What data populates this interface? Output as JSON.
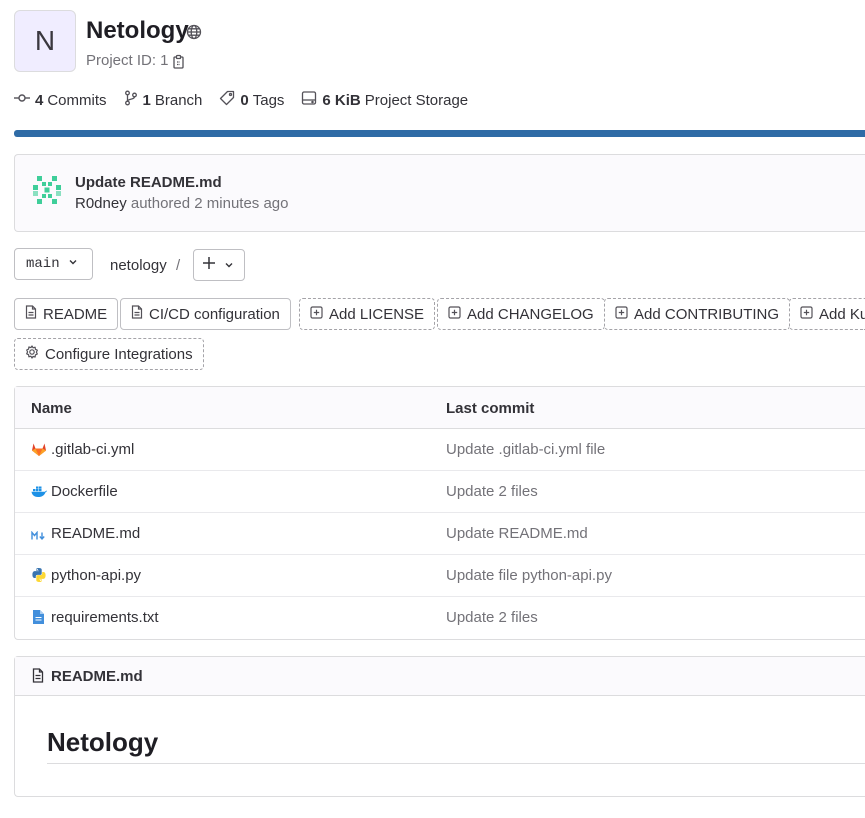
{
  "project": {
    "avatar_letter": "N",
    "name": "Netology",
    "visibility_icon": "globe-icon",
    "id_label": "Project ID: 1"
  },
  "stats": {
    "commits_count": "4",
    "commits_label": "Commits",
    "branches_count": "1",
    "branches_label": "Branch",
    "tags_count": "0",
    "tags_label": "Tags",
    "storage_count": "6 KiB",
    "storage_label": "Project Storage"
  },
  "last_commit": {
    "message": "Update README.md",
    "author": "R0dney",
    "authored": "authored 2 minutes ago"
  },
  "repo_nav": {
    "branch": "main",
    "path": "netology",
    "separator": "/"
  },
  "quick_actions": [
    {
      "label": "README",
      "icon": "file-icon"
    },
    {
      "label": "CI/CD configuration",
      "icon": "file-icon"
    },
    {
      "label": "Add LICENSE",
      "icon": "plus-square-icon"
    },
    {
      "label": "Add CHANGELOG",
      "icon": "plus-square-icon"
    },
    {
      "label": "Add CONTRIBUTING",
      "icon": "plus-square-icon"
    },
    {
      "label": "Add Ku",
      "icon": "plus-square-icon"
    },
    {
      "label": "Configure Integrations",
      "icon": "settings-icon"
    }
  ],
  "file_table": {
    "headers": [
      "Name",
      "Last commit"
    ],
    "rows": [
      {
        "name": ".gitlab-ci.yml",
        "commit": "Update .gitlab-ci.yml file",
        "icon": "gitlab-icon"
      },
      {
        "name": "Dockerfile",
        "commit": "Update 2 files",
        "icon": "docker-icon"
      },
      {
        "name": "README.md",
        "commit": "Update README.md",
        "icon": "markdown-icon"
      },
      {
        "name": "python-api.py",
        "commit": "Update file python-api.py",
        "icon": "python-icon"
      },
      {
        "name": "requirements.txt",
        "commit": "Update 2 files",
        "icon": "text-file-icon"
      }
    ]
  },
  "readme": {
    "file_name": "README.md",
    "heading": "Netology"
  },
  "colors": {
    "progress_bar": "#2f6ba6",
    "avatar_bg": "#f0edff",
    "muted_text": "#737278"
  }
}
